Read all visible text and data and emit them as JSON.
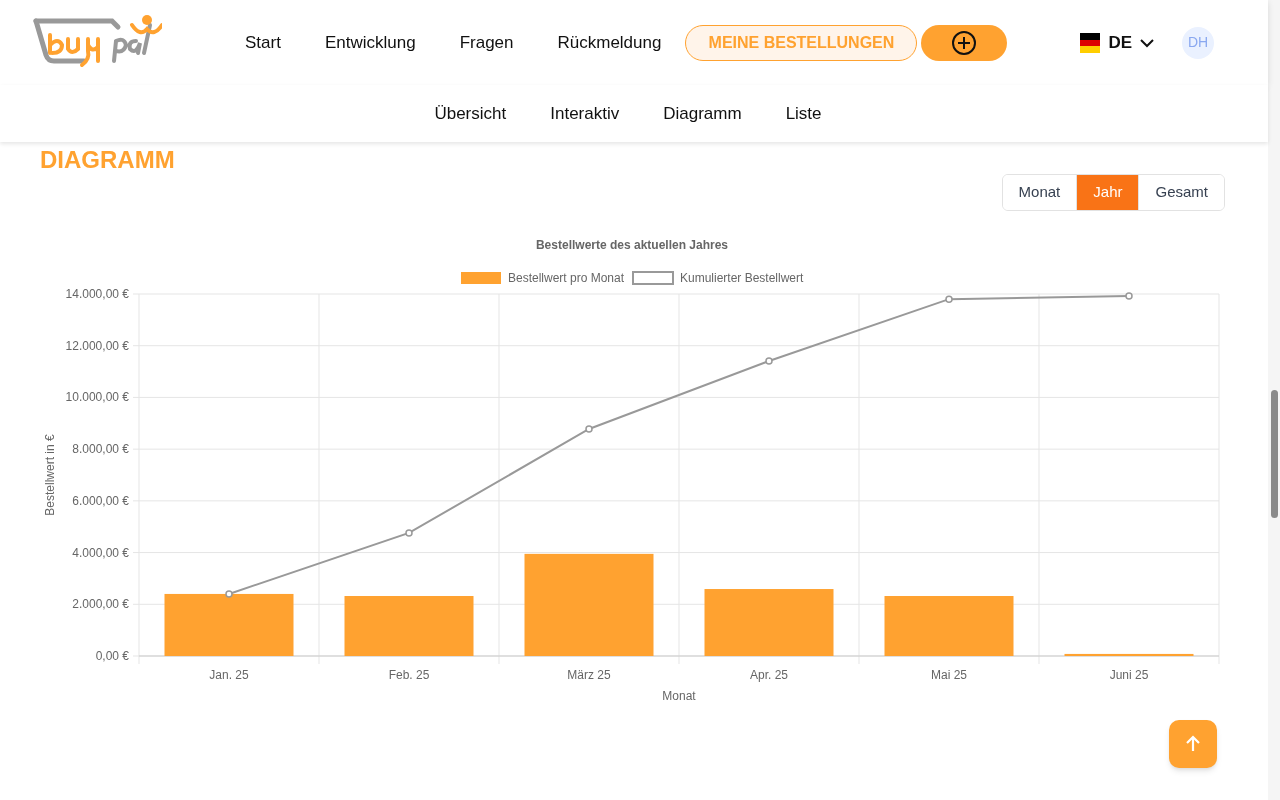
{
  "header": {
    "nav": [
      "Start",
      "Entwicklung",
      "Fragen",
      "Rückmeldung"
    ],
    "orders_button": "MEINE BESTELLUNGEN",
    "language": "DE",
    "avatar": "DH"
  },
  "subnav": [
    "Übersicht",
    "Interaktiv",
    "Diagramm",
    "Liste"
  ],
  "heading": "DIAGRAMM",
  "period_toggle": [
    {
      "label": "Monat",
      "selected": false
    },
    {
      "label": "Jahr",
      "selected": true
    },
    {
      "label": "Gesamt",
      "selected": false
    }
  ],
  "chart_data": {
    "type": "bar",
    "title": "Bestellwerte des aktuellen Jahres",
    "xlabel": "Monat",
    "ylabel": "Bestellwert in €",
    "categories": [
      "Jan. 25",
      "Feb. 25",
      "März 25",
      "Apr. 25",
      "Mai 25",
      "Juni 25"
    ],
    "series": [
      {
        "name": "Bestellwert pro Monat",
        "color": "#ffa230",
        "values": [
          2400,
          2320,
          3950,
          2590,
          2320,
          80
        ]
      },
      {
        "name": "Kumulierter Bestellwert",
        "color": "#999999",
        "type": "line",
        "marker": true,
        "values": [
          2400,
          4760,
          8780,
          11410,
          13800,
          13920
        ]
      }
    ],
    "grid": true,
    "legend": "top",
    "ylim": [
      0,
      14000
    ],
    "yticks": [
      {
        "value": 0,
        "label": "0,00 €"
      },
      {
        "value": 2000,
        "label": "2.000,00 €"
      },
      {
        "value": 4000,
        "label": "4.000,00 €"
      },
      {
        "value": 6000,
        "label": "6.000,00 €"
      },
      {
        "value": 8000,
        "label": "8.000,00 €"
      },
      {
        "value": 10000,
        "label": "10.000,00 €"
      },
      {
        "value": 12000,
        "label": "12.000,00 €"
      },
      {
        "value": 14000,
        "label": "14.000,00 €"
      }
    ]
  }
}
